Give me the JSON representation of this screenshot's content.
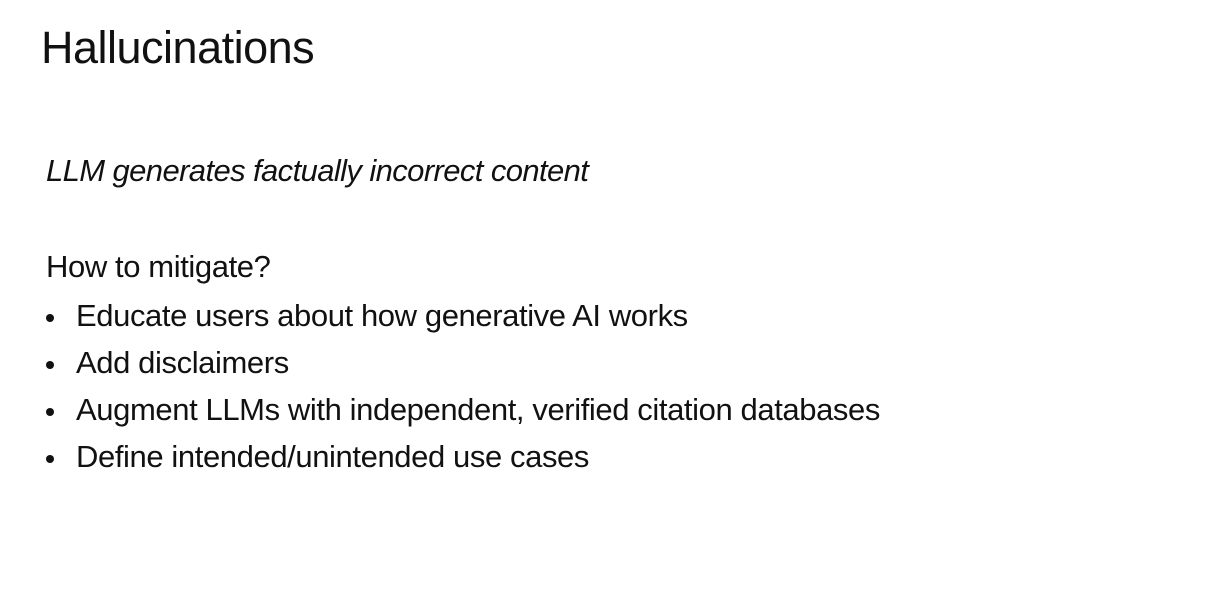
{
  "slide": {
    "title": "Hallucinations",
    "subtitle": "LLM generates factually incorrect content",
    "question": "How to mitigate?",
    "bullets": [
      "Educate users about how generative AI works",
      "Add disclaimers",
      "Augment LLMs with independent, verified citation databases",
      "Define intended/unintended use cases"
    ]
  }
}
